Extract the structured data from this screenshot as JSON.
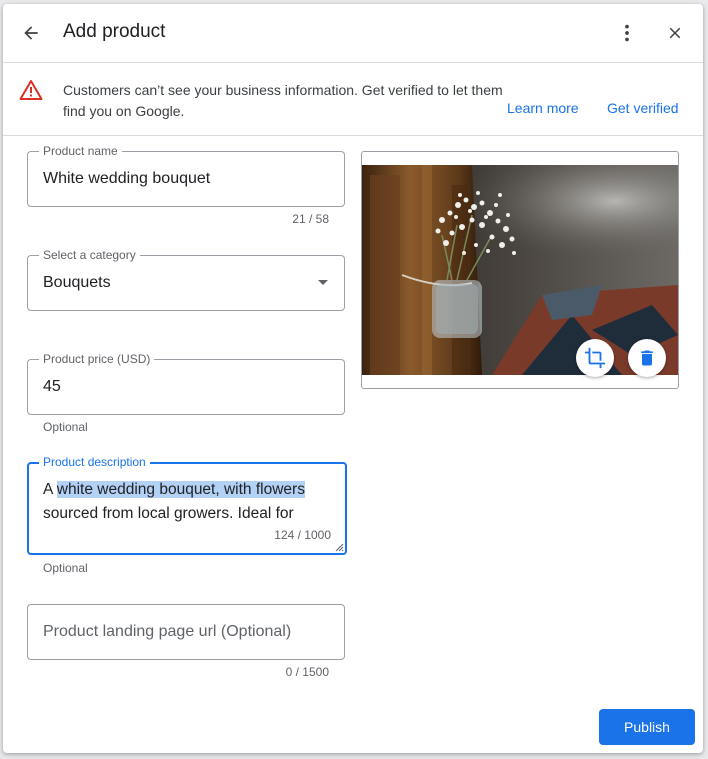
{
  "dialog": {
    "title": "Add product"
  },
  "banner": {
    "message": "Customers can’t see your business information. Get verified to let them find you on Google.",
    "learn_more": "Learn more",
    "get_verified": "Get verified",
    "warning_color": "#d93025"
  },
  "form": {
    "product_name": {
      "label": "Product name",
      "value": "White wedding bouquet",
      "counter": "21 / 58"
    },
    "category": {
      "label": "Select a category",
      "value": "Bouquets"
    },
    "price": {
      "label": "Product price (USD)",
      "value": "45",
      "helper": "Optional"
    },
    "description": {
      "label": "Product description",
      "prefix": "A ",
      "selected": "white wedding bouquet, with flowers",
      "rest": "sourced from local growers. Ideal for",
      "counter": "124 / 1000",
      "helper": "Optional"
    },
    "landing_url": {
      "placeholder": "Product landing page url (Optional)",
      "counter": "0 / 1500"
    }
  },
  "image": {
    "subject": "jar of baby's breath flowers hanging on a church pew",
    "crop_icon": "crop-icon",
    "delete_icon": "trash-icon"
  },
  "actions": {
    "publish": "Publish"
  },
  "colors": {
    "accent": "#1a73e8",
    "selection": "#b3d1f5"
  }
}
